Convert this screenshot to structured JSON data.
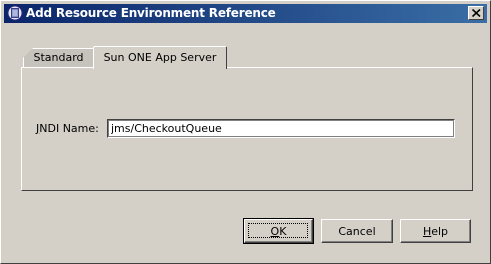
{
  "window": {
    "title": "Add Resource Environment Reference",
    "title_icon": "app-server-icon",
    "close_icon": "close-icon"
  },
  "tabs": [
    {
      "label": "Standard",
      "selected": false
    },
    {
      "label": "Sun ONE App Server",
      "selected": true
    }
  ],
  "form": {
    "jndi_label_mnemonic": "J",
    "jndi_label_rest": "NDI Name:",
    "jndi_value": "jms/CheckoutQueue"
  },
  "buttons": {
    "ok_mnemonic": "O",
    "ok_rest": "K",
    "cancel": "Cancel",
    "help_mnemonic": "H",
    "help_rest": "elp"
  },
  "colors": {
    "title_start": "#0a246a",
    "title_end": "#3a6ea5",
    "face": "#d4d0c8"
  }
}
